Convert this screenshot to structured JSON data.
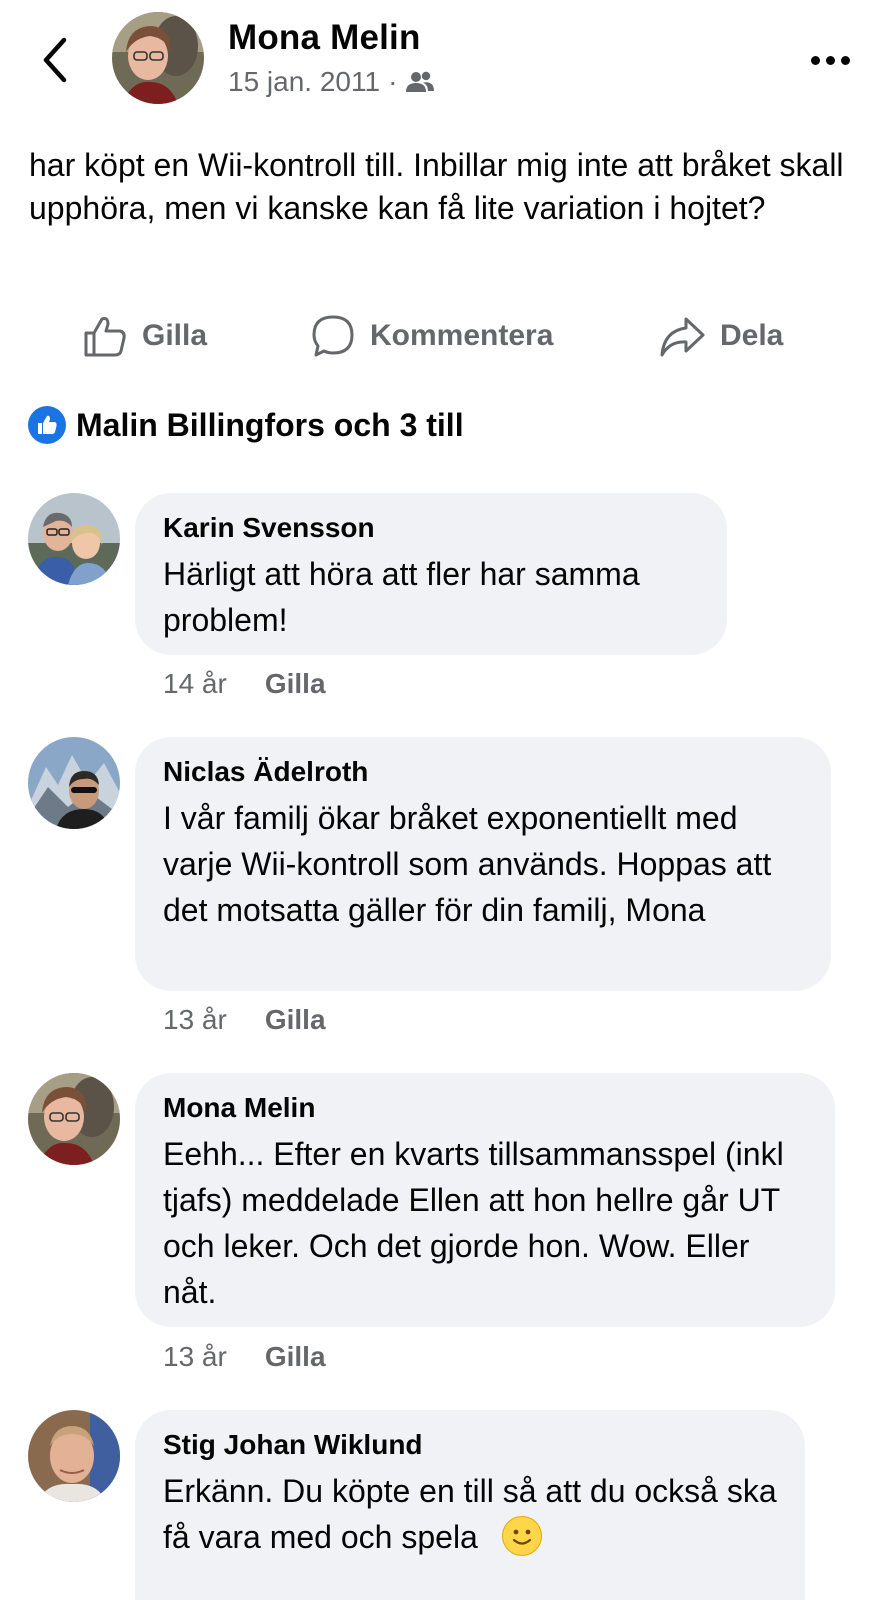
{
  "post": {
    "author": "Mona Melin",
    "date": "15 jan. 2011",
    "separator": "·",
    "audience_icon": "friends-icon",
    "text": "har köpt en Wii-kontroll till. Inbillar mig inte att bråket skall upphöra, men vi kanske kan få lite variation i hojtet?"
  },
  "actions": {
    "like": "Gilla",
    "comment": "Kommentera",
    "share": "Dela"
  },
  "reactions": {
    "text": "Malin Billingfors och 3 till",
    "icon": "like-badge-icon"
  },
  "comments": [
    {
      "name": "Karin Svensson",
      "text": "Härligt att höra att fler har samma problem!",
      "time": "14 år",
      "like": "Gilla"
    },
    {
      "name": "Niclas Ädelroth",
      "text": "I vår familj ökar bråket exponentiellt med varje Wii-kontroll som används. Hoppas att det motsatta gäller för din familj, Mona",
      "time": "13 år",
      "like": "Gilla"
    },
    {
      "name": "Mona Melin",
      "text": "Eehh... Efter en kvarts tillsammansspel (inkl tjafs) meddelade Ellen att hon hellre går UT och leker. Och det gjorde hon. Wow. Eller nåt.",
      "time": "13 år",
      "like": "Gilla"
    },
    {
      "name": "Stig Johan Wiklund",
      "text": "Erkänn. Du köpte en till så att du också ska få vara med och spela",
      "emoji": "slightly-smiling-face"
    }
  ],
  "colors": {
    "accent": "#1b74e4",
    "secondary_text": "#65676b",
    "bubble_bg": "#f0f2f5"
  }
}
